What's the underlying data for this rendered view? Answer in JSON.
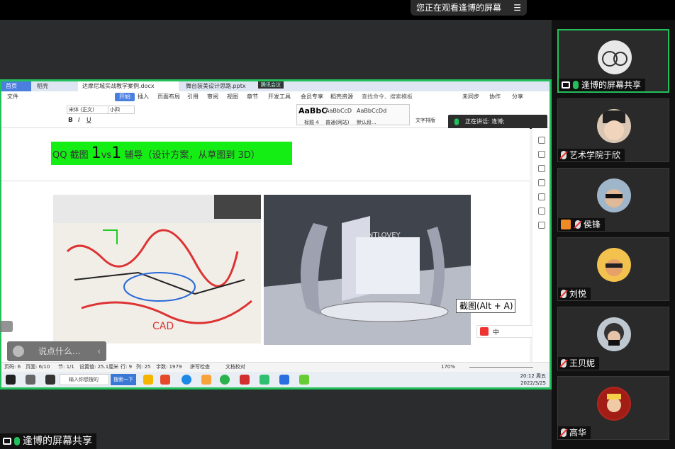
{
  "banner": {
    "viewing_text": "您正在观看逢博的屏幕",
    "menu_glyph": "☰"
  },
  "share": {
    "label": "逢博的屏幕共享"
  },
  "word": {
    "tabs": {
      "home": "首页",
      "find": "稻壳",
      "doc": "达摩尼城实战教学案例.docx",
      "ppt": "舞台装美设计思路.pptx",
      "meeting_tag": "腾讯会议"
    },
    "menu": [
      "文件",
      "开始",
      "插入",
      "页面布局",
      "引用",
      "审阅",
      "视图",
      "章节",
      "开发工具",
      "会员专享",
      "稻壳资源"
    ],
    "menu_search": "查找命令、搜索模板",
    "menu_right": [
      "未同步",
      "协作",
      "分享"
    ],
    "font_name": "宋体 (正文)",
    "font_size": "小四",
    "styles": [
      {
        "sample": "AaBbC",
        "name": "标题 4"
      },
      {
        "sample": "AaBbCcD",
        "name": "普通(网站)"
      },
      {
        "sample": "AaBbCcDd",
        "name": "默认段..."
      }
    ],
    "text_layout": "文字排版",
    "speaking": "正在讲话: 逢博;",
    "headline": {
      "prefix": "QQ 截图 ",
      "num1": "1",
      "vs": "vs",
      "num2": "1",
      "suffix": " 辅导（设计方案，从草图到 3D）"
    },
    "tooltip": "截图(Alt + A)",
    "render_text": "ZNTLOVEY",
    "status": {
      "page": "页码: 6",
      "pages": "页面: 6/10",
      "section": "节: 1/1",
      "pos": "设置值: 25.1厘米",
      "row": "行: 9",
      "col": "列: 25",
      "words": "字数: 1979",
      "spell": "拼写检查",
      "proof": "文档校对",
      "zoom": "170%"
    },
    "taskbar": {
      "search_placeholder": "输入你想搜的",
      "search_btn": "搜索一下",
      "time": "20:12 周五",
      "date": "2022/3/25"
    },
    "ime": "中"
  },
  "chat": {
    "placeholder": "说点什么...",
    "collapse": "‹"
  },
  "participants": [
    {
      "name": "逢博的屏幕共享",
      "active": true
    },
    {
      "name": "艺术学院于欣",
      "active": false
    },
    {
      "name": "侯锋",
      "active": false
    },
    {
      "name": "刘悦",
      "active": false
    },
    {
      "name": "王贝妮",
      "active": false
    },
    {
      "name": "高华",
      "active": false
    }
  ],
  "colors": {
    "share_green": "#22c05a",
    "highlight_green": "#15ee15",
    "wps_blue": "#4a7fe0"
  }
}
